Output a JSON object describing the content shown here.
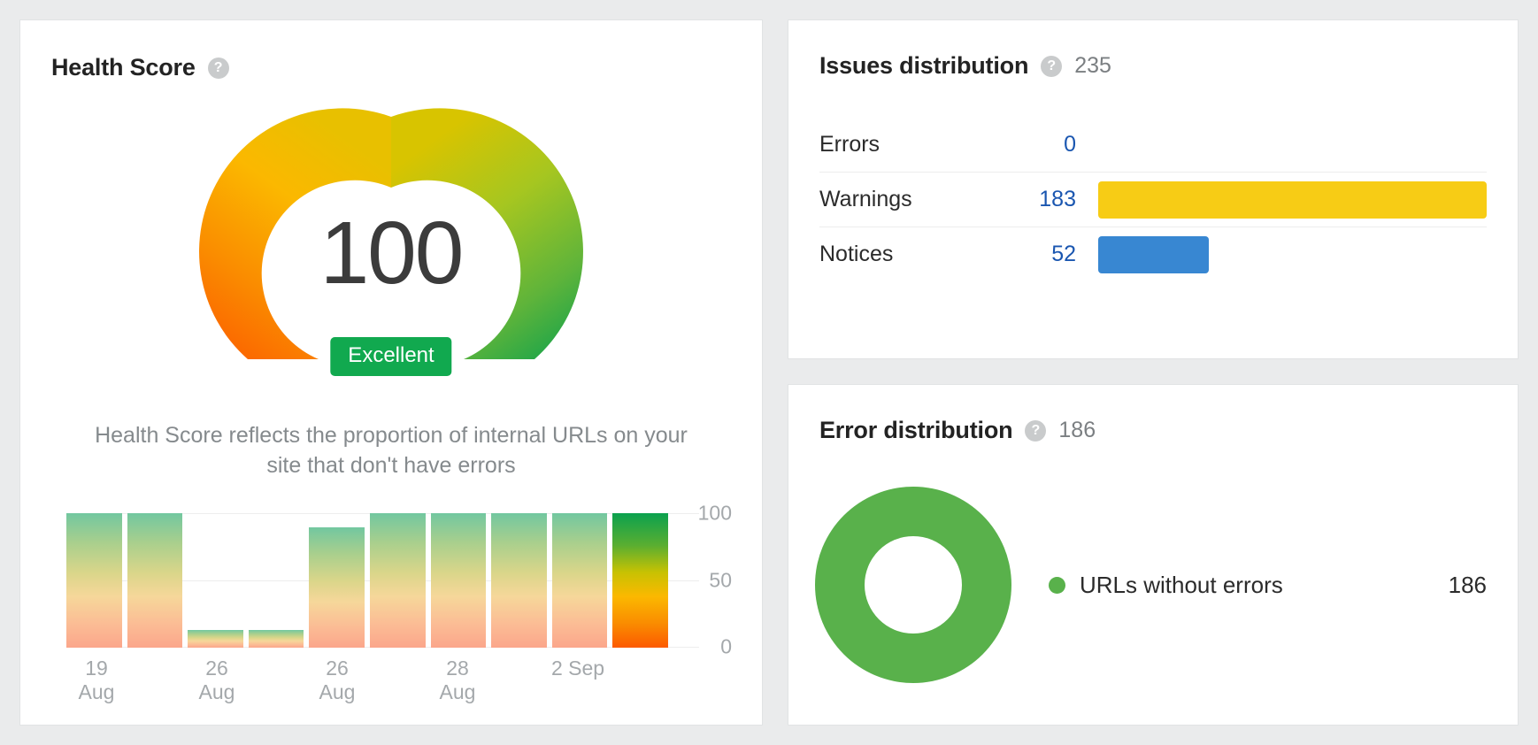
{
  "health": {
    "title": "Health Score",
    "help_icon": "help-circle-icon",
    "score": "100",
    "badge": "Excellent",
    "description": "Health Score reflects the proportion of internal URLs on your site that don't have errors",
    "badge_color": "#11a94f",
    "gauge_start_color": "#fc5a00",
    "gauge_end_color": "#0ba14e"
  },
  "issues": {
    "title": "Issues distribution",
    "help_icon": "help-circle-icon",
    "total": "235",
    "rows": [
      {
        "label": "Errors",
        "count": "0",
        "value": 0,
        "color": "#e03b3b"
      },
      {
        "label": "Warnings",
        "count": "183",
        "value": 183,
        "color": "#f7cc15"
      },
      {
        "label": "Notices",
        "count": "52",
        "value": 52,
        "color": "#3887d2"
      }
    ]
  },
  "error_distribution": {
    "title": "Error distribution",
    "help_icon": "help-circle-icon",
    "total": "186",
    "legend": [
      {
        "label": "URLs without errors",
        "value": "186",
        "color": "#59b14b"
      }
    ]
  },
  "chart_data": [
    {
      "type": "bar",
      "title": "Health Score history",
      "x": [
        "19 Aug",
        "",
        "26 Aug",
        "",
        "26 Aug",
        "",
        "28 Aug",
        "",
        "2 Sep",
        ""
      ],
      "tick_labels": [
        "19 Aug",
        "26 Aug",
        "26 Aug",
        "28 Aug",
        "2 Sep"
      ],
      "values": [
        100,
        100,
        13,
        13,
        89,
        100,
        100,
        100,
        100,
        100
      ],
      "ylabel": "",
      "xlabel": "",
      "ylim": [
        0,
        100
      ],
      "yticks": [
        "100",
        "50",
        "0"
      ],
      "grid": true,
      "legend": "none"
    },
    {
      "type": "bar",
      "title": "Issues distribution",
      "orientation": "horizontal",
      "categories": [
        "Errors",
        "Warnings",
        "Notices"
      ],
      "values": [
        0,
        183,
        52
      ],
      "colors": [
        "#e03b3b",
        "#f7cc15",
        "#3887d2"
      ],
      "total": 235,
      "grid": false,
      "legend": "none"
    },
    {
      "type": "pie",
      "title": "Error distribution",
      "labels": [
        "URLs without errors"
      ],
      "values": [
        186
      ],
      "colors": [
        "#59b14b"
      ],
      "total": 186,
      "legend": "right"
    }
  ]
}
